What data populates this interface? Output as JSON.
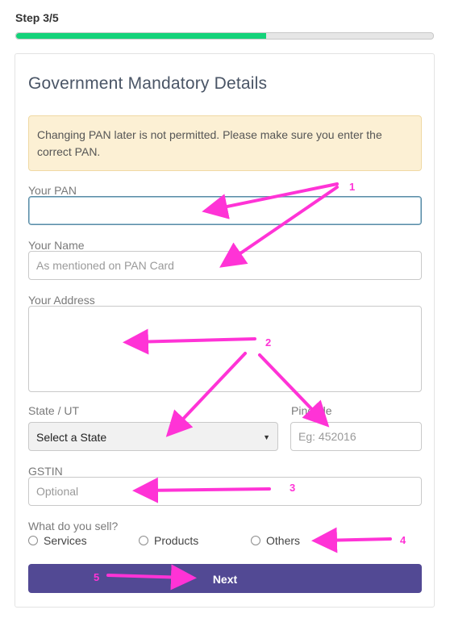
{
  "step_label": "Step 3/5",
  "progress_fraction": 0.6,
  "form": {
    "title": "Government Mandatory Details",
    "alert": "Changing PAN later is not permitted. Please make sure you enter the correct PAN.",
    "pan": {
      "label": "Your PAN",
      "value": "",
      "placeholder": ""
    },
    "name": {
      "label": "Your Name",
      "placeholder": "As mentioned on PAN Card"
    },
    "address": {
      "label": "Your Address",
      "placeholder": ""
    },
    "state": {
      "label": "State / UT",
      "selected": "Select a State"
    },
    "pincode": {
      "label": "Pincode",
      "placeholder": "Eg: 452016"
    },
    "gstin": {
      "label": "GSTIN",
      "placeholder": "Optional"
    },
    "sell": {
      "question": "What do you sell?",
      "options": [
        "Services",
        "Products",
        "Others"
      ]
    },
    "next_label": "Next"
  },
  "annotations": [
    "1",
    "2",
    "3",
    "4",
    "5"
  ],
  "colors": {
    "progress": "#14d37a",
    "button": "#524994",
    "annotation": "#ff33d6",
    "alert_bg": "#fcf0d4"
  }
}
